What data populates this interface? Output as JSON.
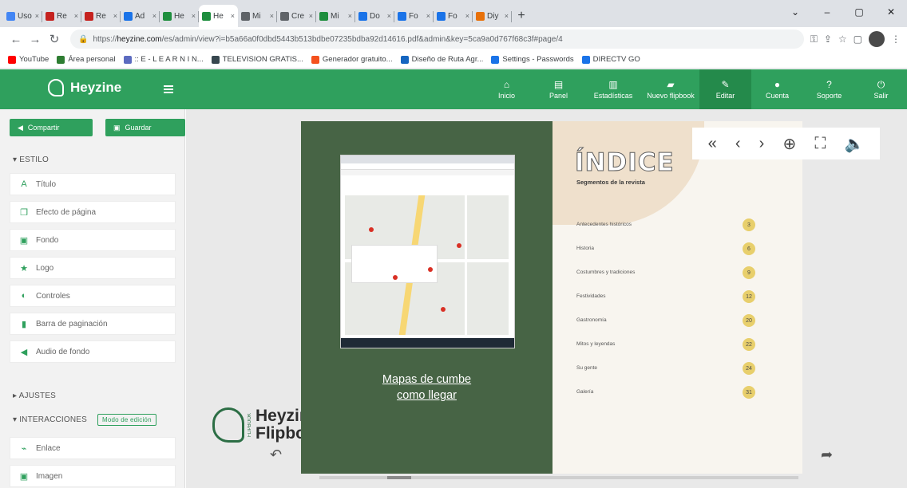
{
  "browser": {
    "tabs": [
      {
        "label": "Uso",
        "color": "#4285f4",
        "active": false
      },
      {
        "label": "Re",
        "color": "#c5221f",
        "active": false
      },
      {
        "label": "Re",
        "color": "#c5221f",
        "active": false
      },
      {
        "label": "Ad",
        "color": "#1a73e8",
        "active": false
      },
      {
        "label": "He",
        "color": "#1e8e3e",
        "active": false
      },
      {
        "label": "He",
        "color": "#1e8e3e",
        "active": true
      },
      {
        "label": "Mi",
        "color": "#5f6368",
        "active": false
      },
      {
        "label": "Cre",
        "color": "#5f6368",
        "active": false
      },
      {
        "label": "Mi",
        "color": "#1e8e3e",
        "active": false
      },
      {
        "label": "Do",
        "color": "#1a73e8",
        "active": false
      },
      {
        "label": "Fo",
        "color": "#1a73e8",
        "active": false
      },
      {
        "label": "Fo",
        "color": "#1a73e8",
        "active": false
      },
      {
        "label": "Diy",
        "color": "#e8710a",
        "active": false
      }
    ],
    "tab_close": "×",
    "new_tab": "+",
    "window_controls": {
      "minimize": "–",
      "restore": "▢",
      "close": "✕",
      "menu": "⌄"
    },
    "url_prefix": "https://",
    "url_host": "heyzine.com",
    "url_rest": "/es/admin/view?i=b5a66a0f0dbd5443b513bdbe07235bdba92d14616.pdf&admin&key=5ca9a0d767f68c3f#page/4",
    "bookmarks": [
      {
        "label": "YouTube",
        "color": "#ff0000"
      },
      {
        "label": "Área personal",
        "color": "#2e7d32"
      },
      {
        "label": ":: E - L E A R N I N...",
        "color": "#5c6bc0"
      },
      {
        "label": "TELEVISION GRATIS...",
        "color": "#37474f"
      },
      {
        "label": "Generador gratuito...",
        "color": "#f4511e"
      },
      {
        "label": "Diseño de Ruta Agr...",
        "color": "#1565c0"
      },
      {
        "label": "Settings - Passwords",
        "color": "#1a73e8"
      },
      {
        "label": "DIRECTV GO",
        "color": "#1a73e8"
      }
    ]
  },
  "app": {
    "brand": "Heyzine",
    "brand_color": "#2fa05d",
    "nav": [
      {
        "label": "Inicio",
        "icon": "home-icon",
        "glyph": "⌂",
        "active": false
      },
      {
        "label": "Panel",
        "icon": "panel-icon",
        "glyph": "▤",
        "active": false
      },
      {
        "label": "Estadísticas",
        "icon": "chart-icon",
        "glyph": "▥",
        "active": false
      },
      {
        "label": "Nuevo flipbook",
        "icon": "book-icon",
        "glyph": "▰",
        "active": false
      },
      {
        "label": "Editar",
        "icon": "pencil-icon",
        "glyph": "✎",
        "active": true
      },
      {
        "label": "Cuenta",
        "icon": "user-icon",
        "glyph": "●",
        "active": false
      },
      {
        "label": "Soporte",
        "icon": "help-icon",
        "glyph": "?",
        "active": false
      },
      {
        "label": "Salir",
        "icon": "power-icon",
        "glyph": "⏻",
        "active": false
      }
    ]
  },
  "panel": {
    "share_label": "Compartir",
    "save_label": "Guardar",
    "estilo_section": "▾ ESTILO",
    "estilo_items": [
      {
        "label": "Título",
        "icon": "title-icon",
        "glyph": "A"
      },
      {
        "label": "Efecto de página",
        "icon": "page-effect-icon",
        "glyph": "❐"
      },
      {
        "label": "Fondo",
        "icon": "image-icon",
        "glyph": "▣"
      },
      {
        "label": "Logo",
        "icon": "star-icon",
        "glyph": "★"
      },
      {
        "label": "Controles",
        "icon": "toggle-icon",
        "glyph": "◐"
      },
      {
        "label": "Barra de paginación",
        "icon": "bookmark-icon",
        "glyph": "▮"
      },
      {
        "label": "Audio de fondo",
        "icon": "speaker-icon",
        "glyph": "◀"
      }
    ],
    "ajustes_section": "▸ AJUSTES",
    "interacciones_section": "▾ INTERACCIONES",
    "modo_edicion": "Modo de edición",
    "interacciones_items": [
      {
        "label": "Enlace",
        "icon": "link-icon",
        "glyph": "⌁"
      },
      {
        "label": "Imagen",
        "icon": "image-icon",
        "glyph": "▣"
      }
    ]
  },
  "flipbook": {
    "brand_line1": "Heyzin",
    "brand_line2": "Flipbo",
    "brand_side": "FLIPBOOK",
    "left_page": {
      "link_line1": "Mapas de cumbe",
      "link_line2": "como llegar"
    },
    "right_page": {
      "title": "ÍNDICE",
      "subtitle": "Segmentos de la revista",
      "items": [
        {
          "name": "Antecedentes históricos",
          "page": "3"
        },
        {
          "name": "Historia",
          "page": "6"
        },
        {
          "name": "Costumbres y tradiciones",
          "page": "9"
        },
        {
          "name": "Festividades",
          "page": "12"
        },
        {
          "name": "Gastronomía",
          "page": "20"
        },
        {
          "name": "Mitos y leyendas",
          "page": "22"
        },
        {
          "name": "Su gente",
          "page": "24"
        },
        {
          "name": "Galería",
          "page": "31"
        }
      ]
    },
    "viewer_controls": [
      {
        "name": "first-page-icon",
        "glyph": "«"
      },
      {
        "name": "prev-page-icon",
        "glyph": "‹"
      },
      {
        "name": "next-page-icon",
        "glyph": "›"
      },
      {
        "name": "zoom-icon",
        "glyph": "⊕"
      },
      {
        "name": "fullscreen-icon",
        "glyph": "⛶"
      },
      {
        "name": "sound-icon",
        "glyph": "🔈"
      }
    ],
    "back_arrow": "↶",
    "share_arrow": "➦"
  }
}
